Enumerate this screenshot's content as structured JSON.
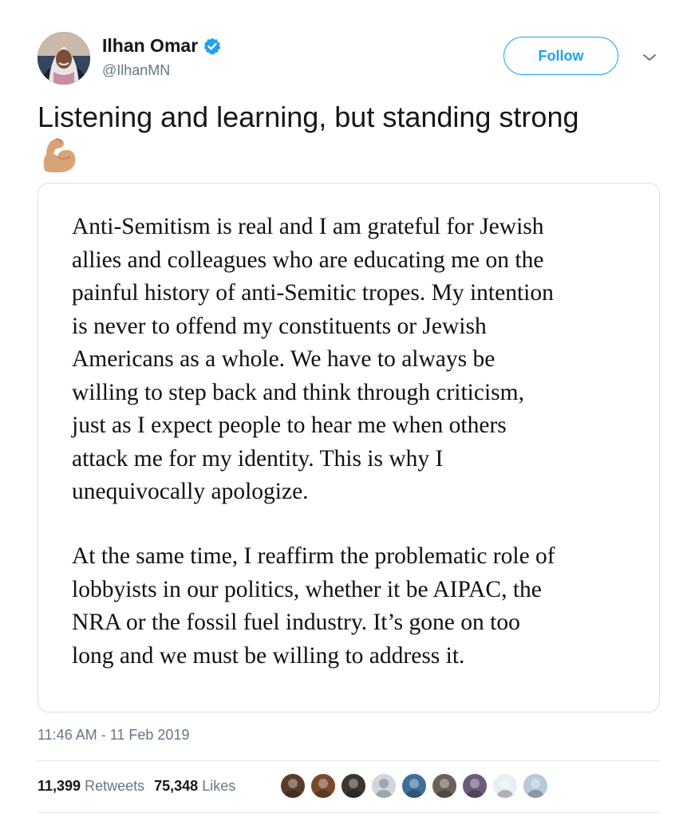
{
  "author": {
    "name": "Ilhan Omar",
    "handle": "@IlhanMN",
    "verified": true,
    "avatar_icon": "profile-photo"
  },
  "follow_button": {
    "label": "Follow"
  },
  "menu_icon": "chevron-down-icon",
  "tweet": {
    "text": "Listening and learning, but standing strong",
    "emoji": "flexed-biceps-medium-light-skin-tone"
  },
  "statement": {
    "paragraph1": "Anti-Semitism is real and I am grateful for Jewish\nallies and colleagues who are educating me on the\npainful history of anti-Semitic tropes. My intention\nis never to offend my constituents or Jewish\nAmericans as a whole. We have to always be\nwilling to step back and think through criticism,\njust as I expect people to hear me when others\nattack me for my identity. This is why I\nunequivocally apologize.",
    "paragraph2": "At the same time, I reaffirm the problematic role of\nlobbyists in our politics, whether it be AIPAC, the\nNRA or the fossil fuel industry. It’s gone on too\nlong and we must be willing to address it."
  },
  "timestamp": "11:46 AM - 11 Feb 2019",
  "stats": {
    "retweets_count": "11,399",
    "retweets_label": "Retweets",
    "likes_count": "75,348",
    "likes_label": "Likes"
  },
  "likers": [
    {
      "color": "#5a3b2b"
    },
    {
      "color": "#7a4a2e"
    },
    {
      "color": "#3a3530"
    },
    {
      "color": "#cfd6dc"
    },
    {
      "color": "#3e6f9a"
    },
    {
      "color": "#6b6158"
    },
    {
      "color": "#6d5a7a"
    },
    {
      "color": "#e8eef2"
    },
    {
      "color": "#b8c9d9"
    }
  ],
  "colors": {
    "accent": "#1da1f2",
    "secondary_text": "#657786",
    "primary_text": "#14171a"
  }
}
